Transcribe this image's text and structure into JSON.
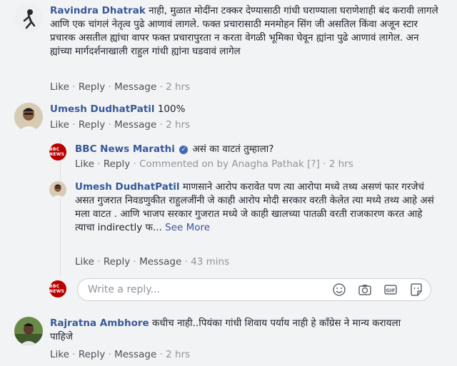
{
  "comments": [
    {
      "author": "Ravindra Dhatrak",
      "text": "नाही, मुळात मोदींना टक्कर देण्यासाठी गांधी घराण्याला घराणेशाही बंद करावी लागले आणि एक चांगलं नेतृत्व पुढे आणावं लागले. फक्त प्रचारासाठी मनमोहन सिंग जी असतिल किंवा अजून स्टार प्रचारक असतील ह्यांचा वापर फक्त प्रचारापुरता न करता वेगळी भूमिका घेवून ह्यांना पुढे आणावं लागेल. अन ह्यांच्या मार्गदर्शनाखाली राहुल गांधी ह्यांना घडवावं लागेल",
      "actions": [
        "Like",
        "Reply",
        "Message"
      ],
      "time": "2 hrs"
    },
    {
      "author": "Umesh DudhatPatil",
      "text": "100%",
      "actions": [
        "Like",
        "Reply",
        "Message"
      ],
      "time": "2 hrs"
    },
    {
      "author": "BBC News Marathi",
      "text": "असं का वाटतं तुम्हाला?",
      "actions": [
        "Like",
        "Reply"
      ],
      "commented_on": "Commented on by Anagha Pathak [?]",
      "time": "2 hrs"
    },
    {
      "author": "Umesh DudhatPatil",
      "text": "माणसाने आरोप करावेत पण त्या आरोपा मध्ये तथ्य असणं फार गरजेचं असत गुजरात निवडणुकीत राहुलजींनी जे काही आरोप मोदी सरकार वरती केलेत त्या मध्ये तथ्य आहे असं मला वाटत . आणि भाजप सरकार गुजरात मध्ये जे काही खालच्या पातळी वरती राजकारण करत आहे त्याचा indirectly फ...",
      "see_more": "See More",
      "actions": [
        "Like",
        "Reply",
        "Message"
      ],
      "time": "43 mins"
    },
    {
      "author": "Rajratna Ambhore",
      "text": "कधीच नाही..पियंका गांधी शिवाय पर्याय नाही हे कॉंग्रेस ने मान्य करायला पाहिजे",
      "actions": [
        "Like",
        "Reply",
        "Message"
      ],
      "time": "2 hrs"
    }
  ],
  "reply_box": {
    "placeholder": "Write a reply..."
  },
  "brand": {
    "bbc_badge": "BBC NEWS",
    "bbc_color": "#b80000",
    "link_color": "#385898"
  },
  "icons": [
    "emoji-icon",
    "camera-icon",
    "gif-icon",
    "sticker-icon",
    "verified-badge-icon"
  ]
}
